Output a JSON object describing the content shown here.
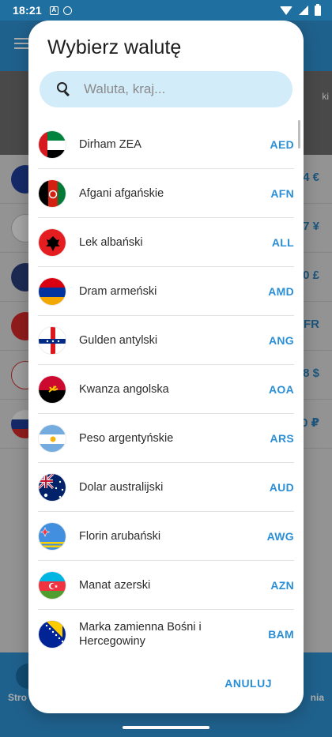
{
  "status_bar": {
    "time": "18:21"
  },
  "background": {
    "subheader_text": "ki",
    "rows": [
      {
        "value": "4 €"
      },
      {
        "value": "7 ¥"
      },
      {
        "value": "0 £"
      },
      {
        "value": "FR"
      },
      {
        "value": "8 $"
      },
      {
        "value": "0 ₽"
      }
    ],
    "bottom_left": "Stro",
    "bottom_right": "nia"
  },
  "dialog": {
    "title": "Wybierz walutę",
    "search": {
      "value": "",
      "placeholder": "Waluta, kraj..."
    },
    "currencies": [
      {
        "name": "Dirham ZEA",
        "code": "AED",
        "flag": "ae"
      },
      {
        "name": "Afgani afgańskie",
        "code": "AFN",
        "flag": "af"
      },
      {
        "name": "Lek albański",
        "code": "ALL",
        "flag": "al"
      },
      {
        "name": "Dram armeński",
        "code": "AMD",
        "flag": "am"
      },
      {
        "name": "Gulden antylski",
        "code": "ANG",
        "flag": "an"
      },
      {
        "name": "Kwanza angolska",
        "code": "AOA",
        "flag": "ao"
      },
      {
        "name": "Peso argentyńskie",
        "code": "ARS",
        "flag": "ar"
      },
      {
        "name": "Dolar australijski",
        "code": "AUD",
        "flag": "au"
      },
      {
        "name": "Florin arubański",
        "code": "AWG",
        "flag": "aw"
      },
      {
        "name": "Manat azerski",
        "code": "AZN",
        "flag": "az"
      },
      {
        "name": "Marka zamienna Bośni i Hercegowiny",
        "code": "BAM",
        "flag": "ba"
      }
    ],
    "cancel_label": "ANULUJ"
  },
  "colors": {
    "accent": "#2b8fd6",
    "header": "#2e8fd0",
    "search_bg": "#d3ecfa"
  }
}
